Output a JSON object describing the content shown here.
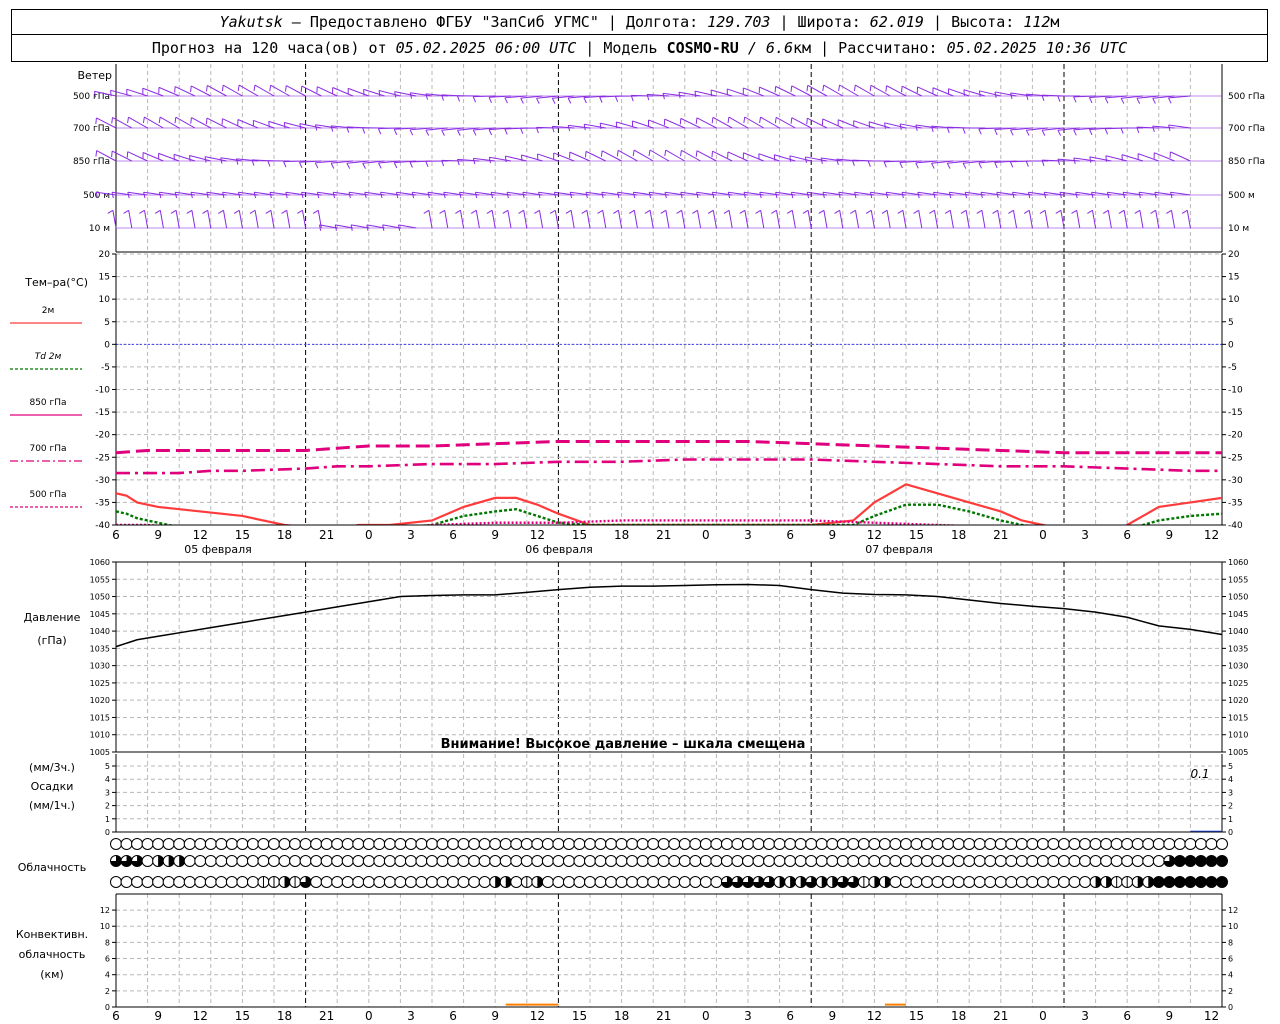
{
  "header": {
    "station": "Yakutsk",
    "dash": " – ",
    "provider": "Предоставлено ФГБУ \"ЗапСиб УГМС\"",
    "sep": " | ",
    "lon_label": "Долгота: ",
    "lon_value": "129.703",
    "lat_label": "Широта: ",
    "lat_value": "62.019",
    "alt_label": "Высота: ",
    "alt_value": "112",
    "alt_unit": "м",
    "forecast_label": "Прогноз на 120 часа(ов)  от ",
    "forecast_start": "05.02.2025 06:00 UTC",
    "model_label": "  | Модель ",
    "model_name": "COSMO-RU",
    "model_res": " / 6.6",
    "model_res_unit": "км",
    "calc_label": " | Рассчитано: ",
    "calc_time": "05.02.2025 10:36 UTC"
  },
  "colors": {
    "grid": "#b8b8b8",
    "wind": "#8a2be2",
    "t2m": "#ff3b3b",
    "td2m": "#007800",
    "t850": "#e0007e",
    "t700": "#e0007e",
    "t500": "#e0007e",
    "zero_line": "#4040ff",
    "pressure": "#000000",
    "precip": "#3050ff",
    "convective": "#ff7f00"
  },
  "chart_data": [
    {
      "type": "wind-barbs",
      "title": "Ветер",
      "levels": [
        "500 гПа",
        "700 гПа",
        "850 гПа",
        "500 м",
        "10  м"
      ],
      "x_hours_from_start": [
        0,
        102
      ],
      "description_levels": "barbs every hour along 5 levels"
    },
    {
      "type": "line",
      "ylabel": "Тем–ра(°С)",
      "ylim": [
        -40,
        20
      ],
      "yticks": [
        20,
        15,
        10,
        5,
        0,
        -5,
        -10,
        -15,
        -20,
        -25,
        -30,
        -35,
        -40
      ],
      "x_ticks": [
        "6",
        "9",
        "12",
        "15",
        "18",
        "21",
        "0",
        "3",
        "6",
        "9",
        "12",
        "15",
        "18",
        "21",
        "0",
        "3",
        "6",
        "9",
        "12",
        "15",
        "18",
        "21",
        "0",
        "3",
        "6",
        "9",
        "12"
      ],
      "x_dates": [
        "05 февраля",
        "06 февраля",
        "07 февраля"
      ],
      "legend": [
        "2м",
        "Td  2м",
        "850 гПа",
        "700 гПа",
        "500 гПа"
      ],
      "series": [
        {
          "name": "2м",
          "x": [
            0,
            1,
            2,
            4,
            8,
            12,
            16,
            21,
            23,
            26,
            30,
            33,
            36,
            38,
            40,
            42,
            45,
            50,
            56,
            62,
            66,
            70,
            72,
            75,
            81,
            84,
            86,
            88,
            90,
            93,
            96,
            99,
            102,
            105
          ],
          "y": [
            -33,
            -33.5,
            -35,
            -36,
            -37,
            -38,
            -40,
            -41,
            -40,
            -40,
            -39,
            -36,
            -34,
            -34,
            -35.5,
            -37.5,
            -40,
            -40,
            -40,
            -40,
            -40,
            -39,
            -35,
            -31,
            -35,
            -37,
            -39,
            -40,
            -41,
            -43,
            -40,
            -36,
            -35,
            -34
          ]
        },
        {
          "name": "Td  2м",
          "x": [
            0,
            1,
            2,
            4,
            6,
            8,
            10,
            12,
            21,
            23,
            26,
            30,
            33,
            36,
            38,
            40,
            42,
            45,
            66,
            70,
            72,
            75,
            78,
            81,
            84,
            86,
            90,
            93,
            96,
            99,
            102,
            105
          ],
          "y": [
            -37,
            -37.5,
            -38.5,
            -39.5,
            -40.5,
            -41,
            -42,
            -43,
            -43,
            -41,
            -41,
            -40,
            -38,
            -37,
            -36.5,
            -38,
            -39.5,
            -40,
            -40,
            -40,
            -38,
            -35.5,
            -35.5,
            -37,
            -39,
            -40,
            -41,
            -43,
            -41,
            -39,
            -38,
            -37.5
          ]
        },
        {
          "name": "850 гПа",
          "x": [
            0,
            3,
            6,
            12,
            18,
            24,
            30,
            36,
            42,
            48,
            54,
            60,
            66,
            72,
            78,
            84,
            90,
            96,
            102,
            105
          ],
          "y": [
            -40,
            -40,
            -40.5,
            -41,
            -41.5,
            -41,
            -40,
            -39.5,
            -39.5,
            -39,
            -39,
            -39,
            -39,
            -39.5,
            -40,
            -40.5,
            -41,
            -41,
            -42,
            -42
          ]
        },
        {
          "name": "700 гПа",
          "x": [
            0,
            3,
            6,
            12,
            18,
            21,
            24,
            30,
            36,
            42,
            48,
            54,
            60,
            66,
            72,
            78,
            84,
            90,
            96,
            102,
            105
          ],
          "y": [
            -24,
            -23.5,
            -23.5,
            -23.5,
            -23.5,
            -23,
            -22.5,
            -22.5,
            -22,
            -21.5,
            -21.5,
            -21.5,
            -21.5,
            -22,
            -22.5,
            -23,
            -23.5,
            -24,
            -24,
            -24,
            -24
          ]
        },
        {
          "name": "500 гПа",
          "x": [
            0,
            3,
            6,
            9,
            12,
            18,
            21,
            24,
            30,
            36,
            42,
            48,
            54,
            60,
            66,
            72,
            78,
            84,
            90,
            96,
            102,
            105
          ],
          "y": [
            -28.5,
            -28.5,
            -28.5,
            -28,
            -28,
            -27.5,
            -27,
            -27,
            -26.5,
            -26.5,
            -26,
            -26,
            -25.5,
            -25.5,
            -25.5,
            -26,
            -26.5,
            -27,
            -27,
            -27.5,
            -28,
            -28
          ]
        }
      ]
    },
    {
      "type": "line",
      "ylabel": "Давление",
      "yunit": "(гПа)",
      "ylim": [
        1005,
        1060
      ],
      "yticks": [
        1060,
        1055,
        1050,
        1045,
        1040,
        1035,
        1030,
        1025,
        1020,
        1015,
        1010,
        1005
      ],
      "warning": "Внимание! Высокое давление – шкала смещена",
      "series": [
        {
          "name": "pressure",
          "x": [
            0,
            1,
            2,
            4,
            6,
            9,
            12,
            15,
            18,
            21,
            24,
            27,
            30,
            33,
            36,
            39,
            42,
            45,
            48,
            51,
            54,
            57,
            60,
            63,
            66,
            69,
            72,
            75,
            78,
            81,
            84,
            87,
            90,
            93,
            96,
            99,
            102,
            105
          ],
          "y": [
            1035.5,
            1036.5,
            1037.5,
            1038.5,
            1039.5,
            1041,
            1042.5,
            1044,
            1045.5,
            1047,
            1048.5,
            1050,
            1050.3,
            1050.5,
            1050.5,
            1051.2,
            1052,
            1052.7,
            1053,
            1053,
            1053.2,
            1053.4,
            1053.5,
            1053.2,
            1052,
            1051,
            1050.6,
            1050.5,
            1050,
            1049,
            1048,
            1047.2,
            1046.5,
            1045.5,
            1044,
            1041.5,
            1040.5,
            1039
          ]
        }
      ]
    },
    {
      "type": "bar",
      "ylabel": "Осадки",
      "yunit_top": "(мм/3ч.)",
      "yunit_bottom": "(мм/1ч.)",
      "ylim": [
        0,
        5
      ],
      "yticks": [
        5,
        4,
        3,
        2,
        1,
        0
      ],
      "annotation": "0.1",
      "series": [
        {
          "name": "precip",
          "x": [
            102,
            105
          ],
          "y": [
            0.1,
            0.1
          ]
        }
      ]
    },
    {
      "type": "cloud-symbols",
      "ylabel": "Облачность",
      "rows": [
        {
          "fill": "0000000000000000000000000000000000000000000000000000000000000000000000000000000000000000000000000000000000"
        },
        {
          "fill": "3330222000000000000000000000000000000000000000000000000000000000000000000000000000000000000000000000344444"
        },
        {
          "fill": "0000000000000011213000000000000000002201200000000000000000333332223223312200000000000000000002211224444444"
        }
      ]
    },
    {
      "type": "bar",
      "ylabel": "Конвективн. облачность (км)",
      "ylim": [
        0,
        13
      ],
      "yticks": [
        12,
        10,
        8,
        6,
        4,
        2,
        0
      ],
      "series": [
        {
          "name": "convective",
          "x": [
            37,
            42,
            73,
            75
          ],
          "y": [
            0.3,
            0.3,
            0.3,
            0.3
          ]
        }
      ]
    }
  ]
}
